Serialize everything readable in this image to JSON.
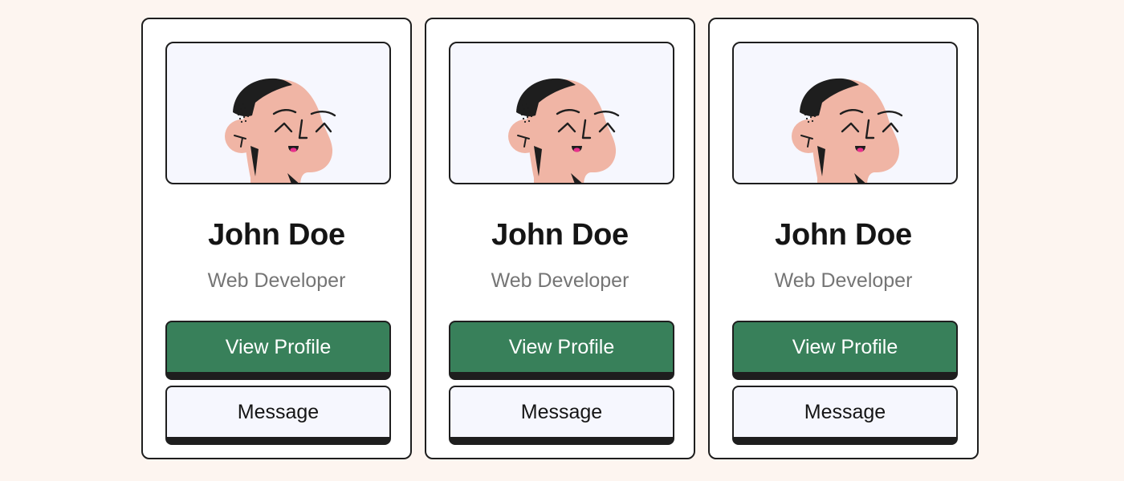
{
  "cards": [
    {
      "avatar_icon": "person-avatar-illustration",
      "name": "John Doe",
      "role": "Web Developer",
      "primary_button": "View Profile",
      "secondary_button": "Message"
    },
    {
      "avatar_icon": "person-avatar-illustration",
      "name": "John Doe",
      "role": "Web Developer",
      "primary_button": "View Profile",
      "secondary_button": "Message"
    },
    {
      "avatar_icon": "person-avatar-illustration",
      "name": "John Doe",
      "role": "Web Developer",
      "primary_button": "View Profile",
      "secondary_button": "Message"
    }
  ],
  "colors": {
    "page_background": "#fdf5f0",
    "card_background": "#ffffff",
    "border": "#1e1e1e",
    "primary_button": "#38805a",
    "secondary_button": "#f6f7fe",
    "skin": "#f0b5a5",
    "hair": "#1e1e1e",
    "tongue": "#e8308c"
  }
}
